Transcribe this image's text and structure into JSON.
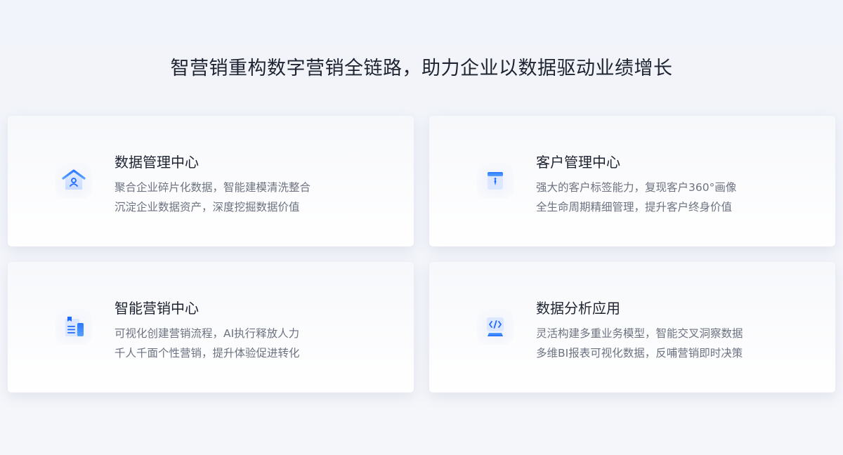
{
  "headline": "智营销重构数字营销全链路，助力企业以数据驱动业绩增长",
  "colors": {
    "accent": "#1f6bff",
    "accent_light": "#5aa2ff",
    "title_text": "#1d2330",
    "body_text": "#6c7280"
  },
  "cards": [
    {
      "icon": "data-management-house-icon",
      "title": "数据管理中心",
      "lines": [
        "聚合企业碎片化数据，智能建模清洗整合",
        "沉淀企业数据资产，深度挖掘数据价值"
      ]
    },
    {
      "icon": "customer-badge-icon",
      "title": "客户管理中心",
      "lines": [
        "强大的客户标签能力，复现客户360°画像",
        "全生命周期精细管理，提升客户终身价值"
      ]
    },
    {
      "icon": "marketing-document-icon",
      "title": "智能营销中心",
      "lines": [
        "可视化创建营销流程，AI执行释放人力",
        "千人千面个性营销，提升体验促进转化"
      ]
    },
    {
      "icon": "code-monitor-icon",
      "title": "数据分析应用",
      "lines": [
        "灵活构建多重业务模型，智能交叉洞察数据",
        "多维BI报表可视化数据，反哺营销即时决策"
      ]
    }
  ]
}
